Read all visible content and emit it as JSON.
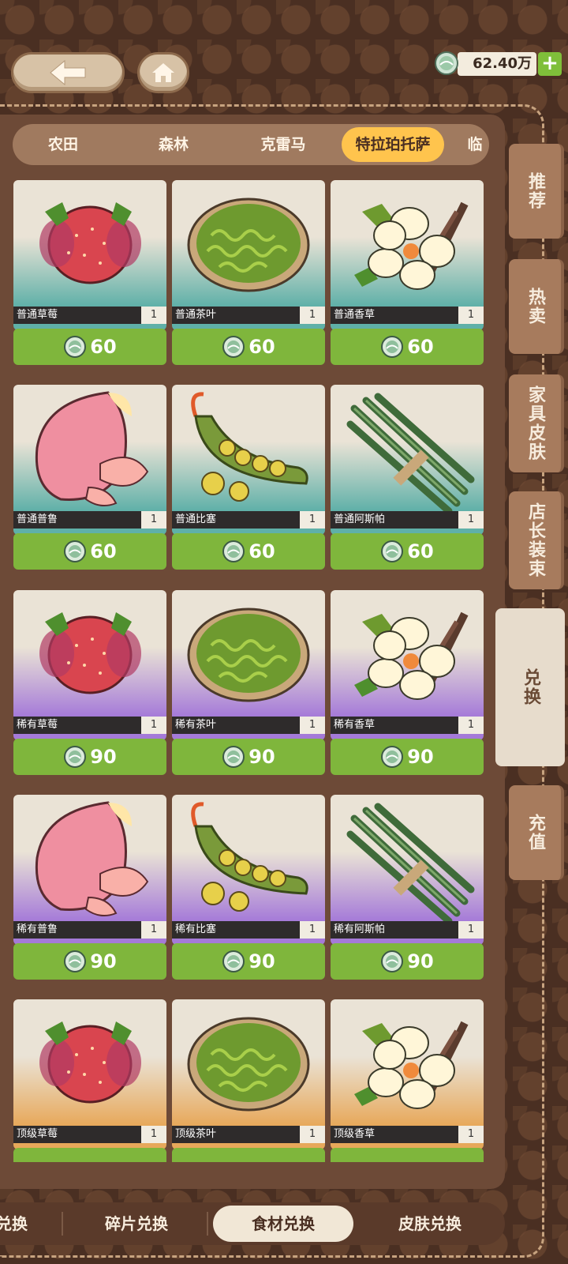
{
  "header": {
    "currency_amount": "62.40万",
    "plus_label": "+"
  },
  "region_tabs": [
    "农田",
    "森林",
    "克雷马",
    "特拉珀托萨",
    "临"
  ],
  "active_region": "特拉珀托萨",
  "side_tabs": [
    "推荐",
    "热卖",
    "家具皮肤",
    "店长装束",
    "兑换",
    "充值"
  ],
  "active_side_tab": "兑换",
  "items": [
    {
      "name": "普通草莓",
      "qty": "1",
      "price": "60",
      "tier": "普通",
      "icon": "strawberry-icon"
    },
    {
      "name": "普通茶叶",
      "qty": "1",
      "price": "60",
      "tier": "普通",
      "icon": "tea-leaves-icon"
    },
    {
      "name": "普通香草",
      "qty": "1",
      "price": "60",
      "tier": "普通",
      "icon": "vanilla-flower-icon"
    },
    {
      "name": "普通普鲁",
      "qty": "1",
      "price": "60",
      "tier": "普通",
      "icon": "pink-fruit-icon"
    },
    {
      "name": "普通比塞",
      "qty": "1",
      "price": "60",
      "tier": "普通",
      "icon": "pea-pod-icon"
    },
    {
      "name": "普通阿斯帕",
      "qty": "1",
      "price": "60",
      "tier": "普通",
      "icon": "asparagus-icon"
    },
    {
      "name": "稀有草莓",
      "qty": "1",
      "price": "90",
      "tier": "稀有",
      "icon": "strawberry-icon"
    },
    {
      "name": "稀有茶叶",
      "qty": "1",
      "price": "90",
      "tier": "稀有",
      "icon": "tea-leaves-icon"
    },
    {
      "name": "稀有香草",
      "qty": "1",
      "price": "90",
      "tier": "稀有",
      "icon": "vanilla-flower-icon"
    },
    {
      "name": "稀有普鲁",
      "qty": "1",
      "price": "90",
      "tier": "稀有",
      "icon": "pink-fruit-icon"
    },
    {
      "name": "稀有比塞",
      "qty": "1",
      "price": "90",
      "tier": "稀有",
      "icon": "pea-pod-icon"
    },
    {
      "name": "稀有阿斯帕",
      "qty": "1",
      "price": "90",
      "tier": "稀有",
      "icon": "asparagus-icon"
    },
    {
      "name": "顶级草莓",
      "qty": "1",
      "price": "",
      "tier": "顶级",
      "icon": "strawberry-icon"
    },
    {
      "name": "顶级茶叶",
      "qty": "1",
      "price": "",
      "tier": "顶级",
      "icon": "tea-leaves-icon"
    },
    {
      "name": "顶级香草",
      "qty": "1",
      "price": "",
      "tier": "顶级",
      "icon": "vanilla-flower-icon"
    }
  ],
  "tier_colors": {
    "普通": "#5fb0a8",
    "稀有": "#a57ad8",
    "顶级": "#e7a85a"
  },
  "bottom_tabs": [
    "兑换",
    "碎片兑换",
    "食材兑换",
    "皮肤兑换"
  ],
  "active_bottom_tab": "食材兑换",
  "colors": {
    "accent": "#ffc44d",
    "price_green": "#7fb63c",
    "panel": "#6d4a37"
  }
}
